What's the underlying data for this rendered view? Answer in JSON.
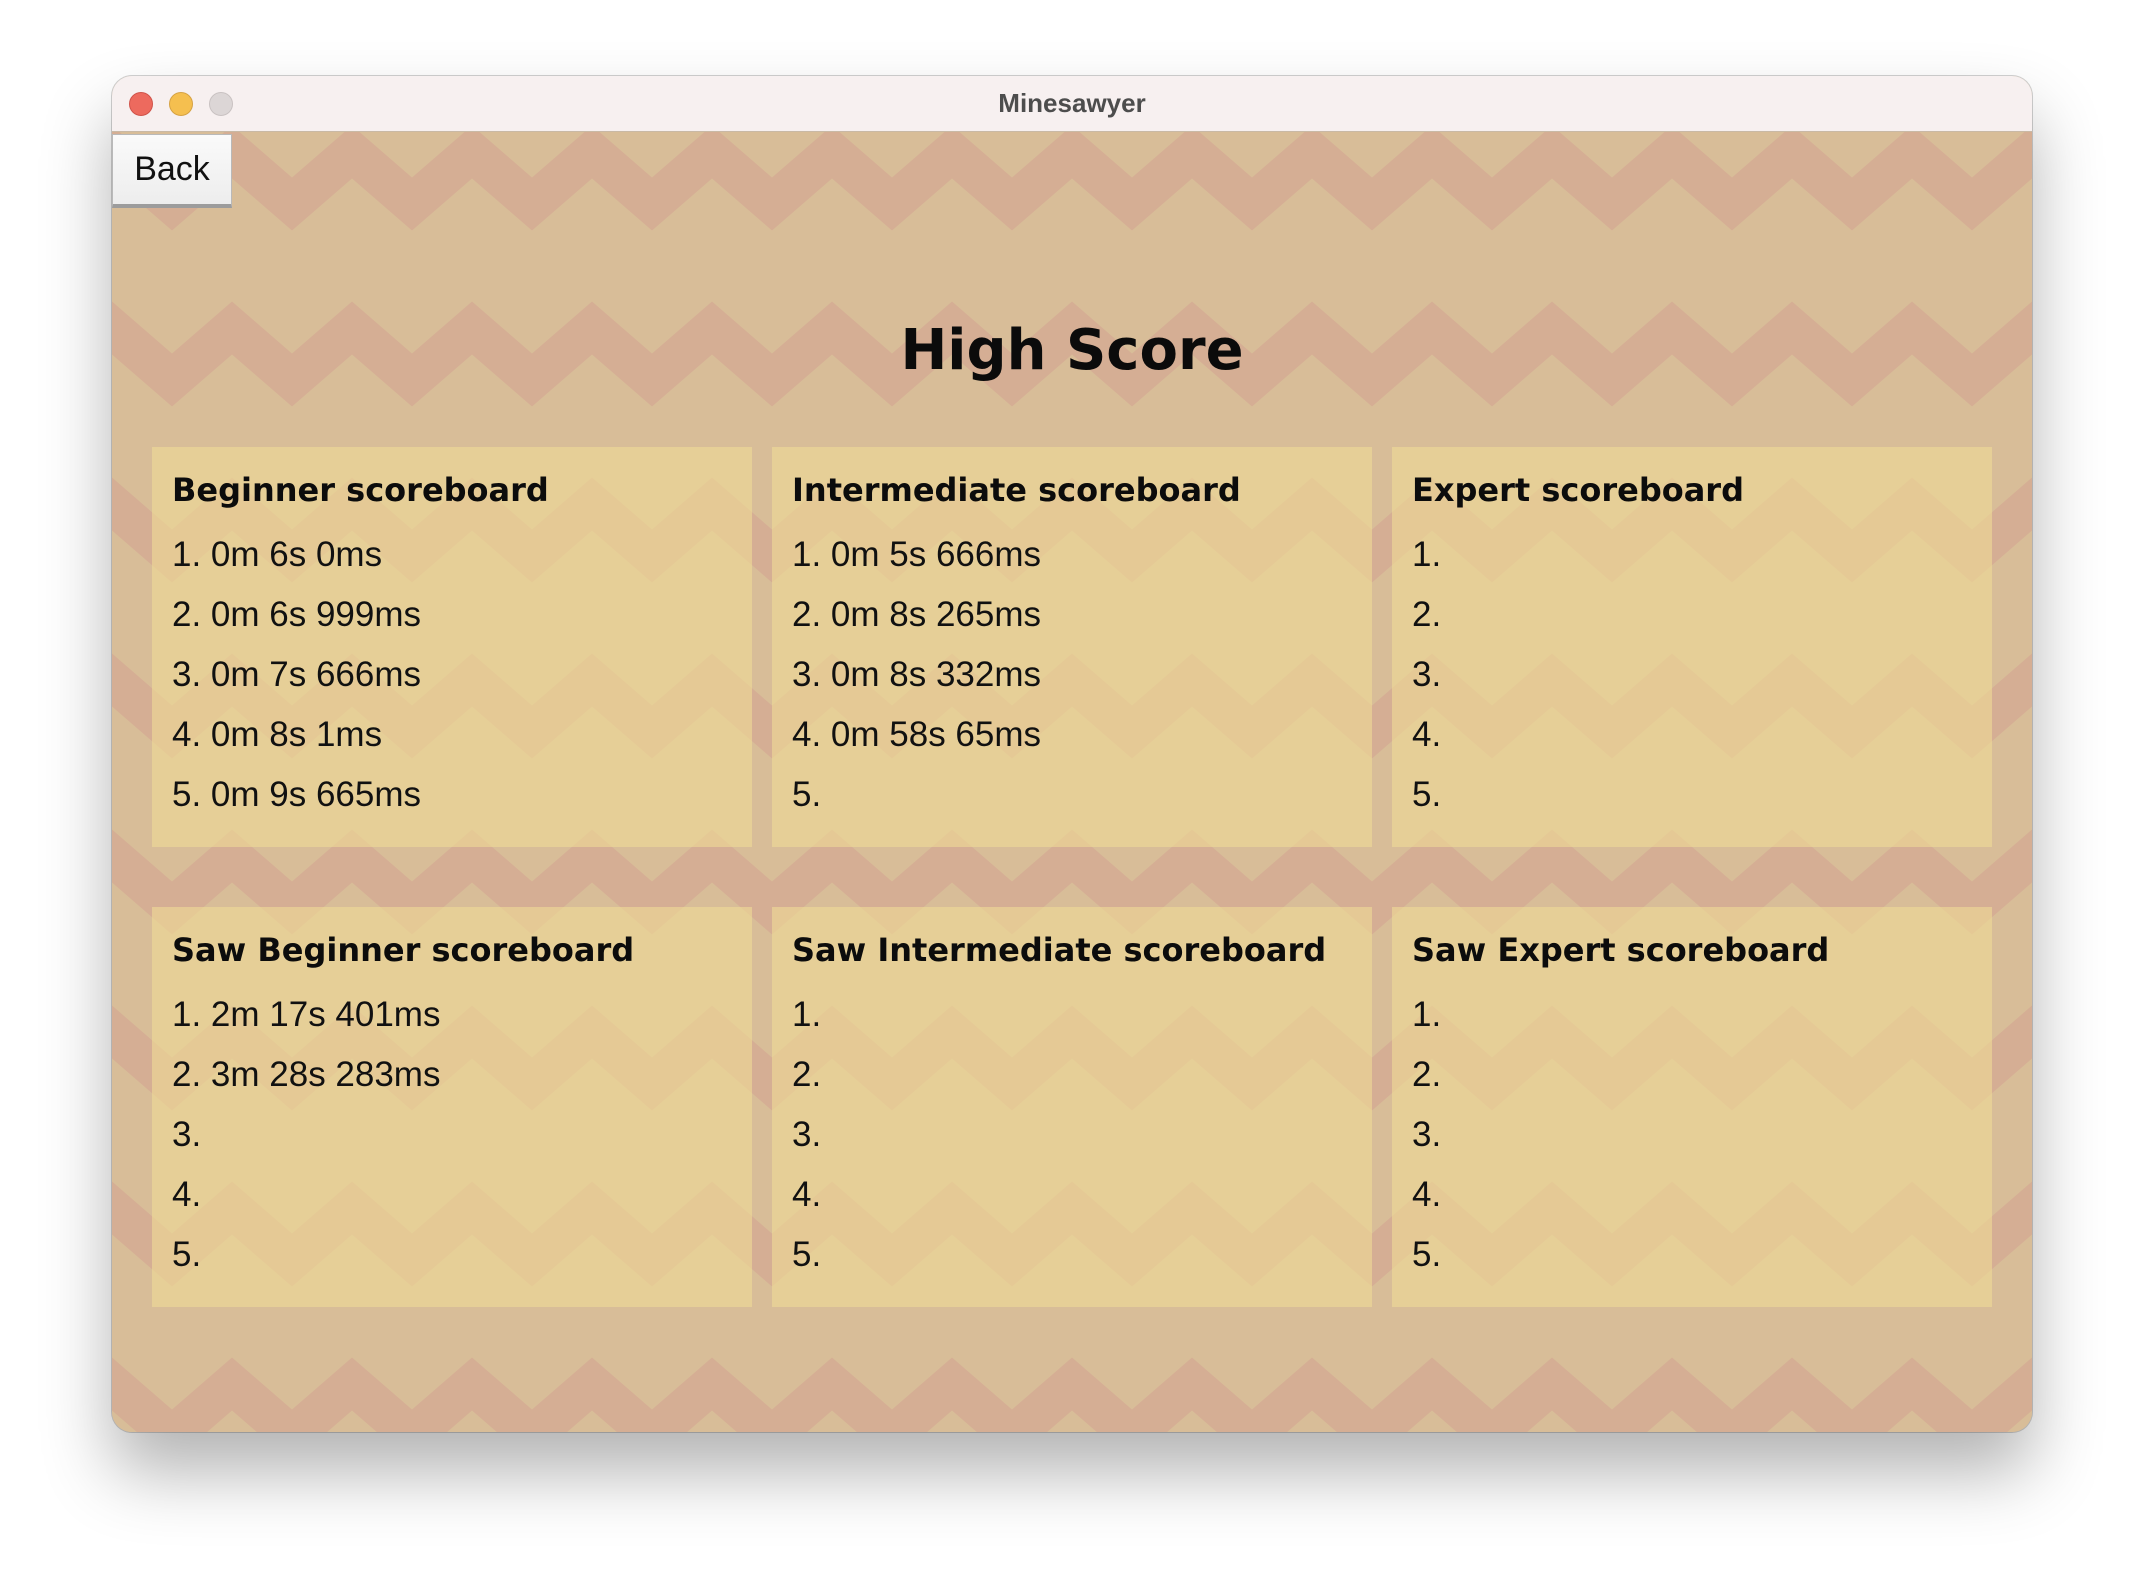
{
  "window": {
    "title": "Minesawyer"
  },
  "toolbar": {
    "back_label": "Back"
  },
  "page": {
    "title": "High Score"
  },
  "scoreboards": [
    {
      "title": "Beginner scoreboard",
      "entries": [
        "1. 0m 6s 0ms",
        "2. 0m 6s 999ms",
        "3. 0m 7s 666ms",
        "4. 0m 8s 1ms",
        "5. 0m 9s 665ms"
      ]
    },
    {
      "title": "Intermediate scoreboard",
      "entries": [
        "1. 0m 5s 666ms",
        "2. 0m 8s 265ms",
        "3. 0m 8s 332ms",
        "4. 0m 58s 65ms",
        "5."
      ]
    },
    {
      "title": "Expert scoreboard",
      "entries": [
        "1.",
        "2.",
        "3.",
        "4.",
        "5."
      ]
    },
    {
      "title": "Saw Beginner scoreboard",
      "entries": [
        "1. 2m 17s 401ms",
        "2. 3m 28s 283ms",
        "3.",
        "4.",
        "5."
      ]
    },
    {
      "title": "Saw Intermediate scoreboard",
      "entries": [
        "1.",
        "2.",
        "3.",
        "4.",
        "5."
      ]
    },
    {
      "title": "Saw Expert scoreboard",
      "entries": [
        "1.",
        "2.",
        "3.",
        "4.",
        "5."
      ]
    }
  ],
  "colors": {
    "background": "#d8bd98",
    "chevron": "#d5ae94",
    "card": "#e6d19a",
    "window_close": "#ed6a5e",
    "window_minimize": "#f5bf4f",
    "window_zoom": "#dcd6d6"
  }
}
